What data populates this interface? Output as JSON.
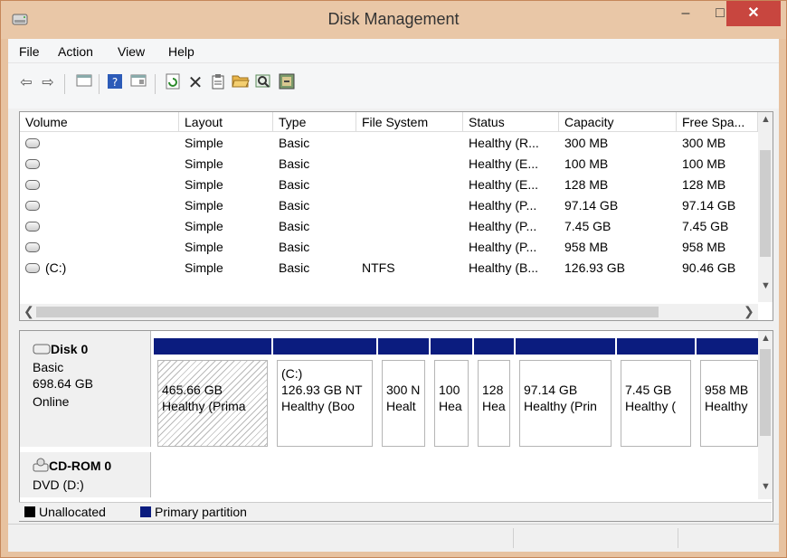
{
  "window": {
    "title": "Disk Management",
    "controls": {
      "minimize": "–",
      "maximize": "□",
      "close": "✕"
    }
  },
  "menu": [
    "File",
    "Action",
    "View",
    "Help"
  ],
  "toolbar": [
    "back-arrow-icon",
    "forward-arrow-icon",
    "console-tree-icon",
    "help-icon",
    "show-pane-icon",
    "refresh-icon",
    "delete-icon",
    "properties-icon",
    "open-folder-icon",
    "search-icon",
    "rescan-disks-icon"
  ],
  "volume_table": {
    "headers": [
      "Volume",
      "Layout",
      "Type",
      "File System",
      "Status",
      "Capacity",
      "Free Spa..."
    ],
    "rows": [
      [
        "",
        "Simple",
        "Basic",
        "",
        "Healthy (R...",
        "300 MB",
        "300 MB"
      ],
      [
        "",
        "Simple",
        "Basic",
        "",
        "Healthy (E...",
        "100 MB",
        "100 MB"
      ],
      [
        "",
        "Simple",
        "Basic",
        "",
        "Healthy (E...",
        "128 MB",
        "128 MB"
      ],
      [
        "",
        "Simple",
        "Basic",
        "",
        "Healthy (P...",
        "97.14 GB",
        "97.14 GB"
      ],
      [
        "",
        "Simple",
        "Basic",
        "",
        "Healthy (P...",
        "7.45 GB",
        "7.45 GB"
      ],
      [
        "",
        "Simple",
        "Basic",
        "",
        "Healthy (P...",
        "958 MB",
        "958 MB"
      ],
      [
        "(C:)",
        "Simple",
        "Basic",
        "NTFS",
        "Healthy (B...",
        "126.93 GB",
        "90.46 GB"
      ]
    ]
  },
  "disk0": {
    "name": "Disk 0",
    "type": "Basic",
    "size": "698.64 GB",
    "state": "Online",
    "partitions": [
      {
        "label": "",
        "size": "465.66 GB",
        "status": "Healthy (Prima",
        "hatched": true
      },
      {
        "label": "(C:)",
        "size": "126.93 GB NT",
        "status": "Healthy (Boo",
        "hatched": false
      },
      {
        "label": "",
        "size": "300 N",
        "status": "Healt",
        "hatched": false
      },
      {
        "label": "",
        "size": "100",
        "status": "Hea",
        "hatched": false
      },
      {
        "label": "",
        "size": "128",
        "status": "Hea",
        "hatched": false
      },
      {
        "label": "",
        "size": "97.14 GB",
        "status": "Healthy (Prin",
        "hatched": false
      },
      {
        "label": "",
        "size": "7.45 GB",
        "status": "Healthy (",
        "hatched": false
      },
      {
        "label": "",
        "size": "958 MB",
        "status": "Healthy",
        "hatched": false
      }
    ]
  },
  "cdrom0": {
    "name": "CD-ROM 0",
    "type": "DVD (D:)"
  },
  "legend": {
    "unallocated": "Unallocated",
    "primary": "Primary partition",
    "unallocated_color": "#000000",
    "primary_color": "#0b1c7f"
  }
}
